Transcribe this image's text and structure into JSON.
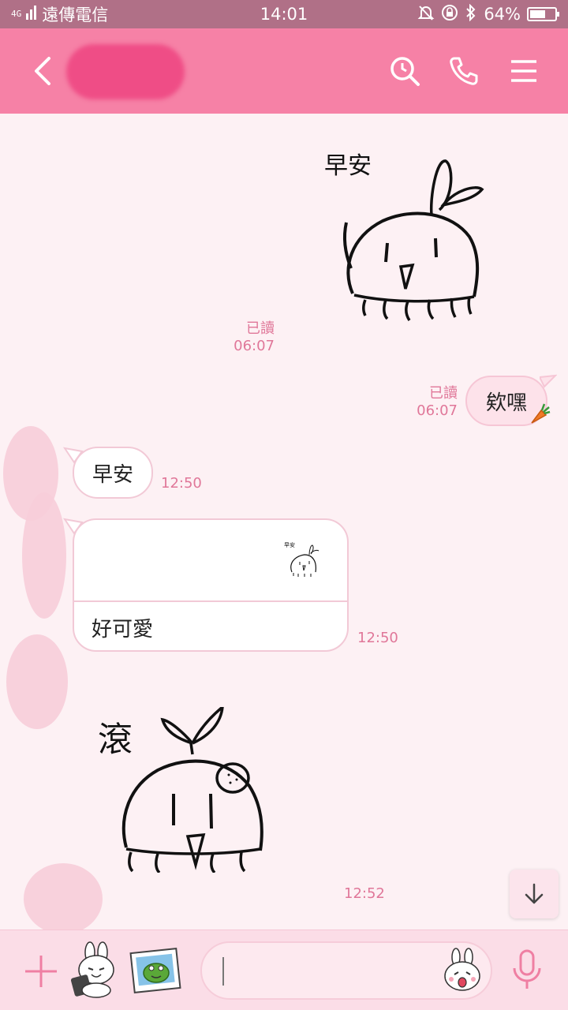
{
  "status_bar": {
    "carrier": "遠傳電信",
    "network": "4G",
    "time": "14:01",
    "battery": "64%",
    "battery_level": 0.64
  },
  "header": {
    "back_icon": "chevron-left-icon",
    "search_icon": "clock-search-icon",
    "call_icon": "phone-icon",
    "menu_icon": "hamburger-menu-icon"
  },
  "messages": [
    {
      "side": "out",
      "type": "sticker",
      "sticker_text": "早安",
      "read_label": "已讀",
      "time": "06:07"
    },
    {
      "side": "out",
      "type": "text",
      "text": "欸嘿",
      "read_label": "已讀",
      "time": "06:07"
    },
    {
      "side": "in",
      "type": "text",
      "text": "早安",
      "time": "12:50"
    },
    {
      "side": "in",
      "type": "reply",
      "quoted_sticker_text": "早安",
      "text": "好可愛",
      "time": "12:50"
    },
    {
      "side": "in",
      "type": "sticker",
      "sticker_text": "滾",
      "time": "12:52"
    }
  ],
  "scroll_down_icon": "arrow-down-icon",
  "input_bar": {
    "plus_icon": "plus-icon",
    "placeholder": "",
    "mic_icon": "microphone-icon"
  },
  "colors": {
    "status_bar": "#b07087",
    "header": "#f681a6",
    "background": "#fdf1f4",
    "accent_text": "#e07799",
    "input_bar": "#fbdde7"
  }
}
